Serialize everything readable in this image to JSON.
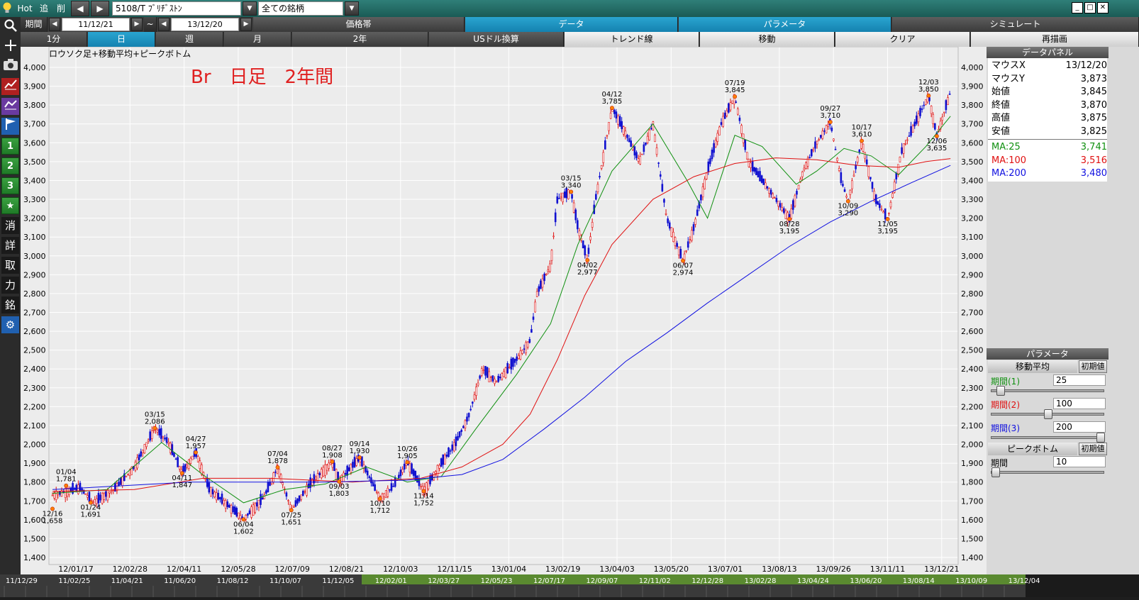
{
  "topbar": {
    "hot_label": "Hot",
    "add_label": "追",
    "delete_label": "削",
    "prev_label": "◀",
    "next_label": "▶",
    "stock_field": "5108/T ﾌﾞﾘﾁﾞｽﾄﾝ",
    "market_select": "全ての銘柄",
    "minimize": "_",
    "restore": "□",
    "close": "✕"
  },
  "toolbar1": {
    "period_label": "期間",
    "start_date": "11/12/21",
    "tilde": "~",
    "end_date": "13/12/20",
    "tabs": [
      "価格帯",
      "データ",
      "パラメータ",
      "シミュレート"
    ]
  },
  "toolbar2": {
    "timeframes": [
      "1分",
      "日",
      "週",
      "月",
      "2年"
    ],
    "actions": [
      "USドル換算",
      "トレンド線",
      "移動",
      "クリア",
      "再描画"
    ]
  },
  "left_toolbar": {
    "numbers": [
      "1",
      "2",
      "3"
    ],
    "kanji": [
      "消",
      "詳",
      "取",
      "力",
      "銘"
    ]
  },
  "chart_header": {
    "title": "ロウソク足+移動平均+ピークボトム",
    "note": "Br　日足　2年間"
  },
  "chart_data": {
    "type": "line",
    "title": "ロウソク足+移動平均+ピークボトム",
    "ylim": [
      1400,
      4000
    ],
    "y_ticks": [
      1400,
      1500,
      1600,
      1700,
      1800,
      1900,
      2000,
      2100,
      2200,
      2300,
      2400,
      2500,
      2600,
      2700,
      2800,
      2900,
      3000,
      3100,
      3200,
      3300,
      3400,
      3500,
      3600,
      3700,
      3800,
      3900,
      4000
    ],
    "y_tick_labels": [
      "1,400",
      "1,500",
      "1,600",
      "1,700",
      "1,800",
      "1,900",
      "2,000",
      "2,100",
      "2,200",
      "2,300",
      "2,400",
      "2,500",
      "2,600",
      "2,700",
      "2,800",
      "2,900",
      "3,000",
      "3,100",
      "3,200",
      "3,300",
      "3,400",
      "3,500",
      "3,600",
      "3,700",
      "3,800",
      "3,900",
      "4,000"
    ],
    "x_tick_labels": [
      "12/01/17",
      "12/02/28",
      "12/04/11",
      "12/05/28",
      "12/07/09",
      "12/08/21",
      "12/10/03",
      "12/11/15",
      "13/01/04",
      "13/02/19",
      "13/04/03",
      "13/05/20",
      "13/07/01",
      "13/08/13",
      "13/09/26",
      "13/11/11",
      "13/12/21"
    ],
    "bottom_dates": [
      "11/12/29",
      "11/02/25",
      "11/04/21",
      "11/06/20",
      "11/08/12",
      "11/10/07",
      "11/12/05",
      "12/02/01",
      "12/03/27",
      "12/05/23",
      "12/07/17",
      "12/09/07",
      "12/11/02",
      "12/12/28",
      "13/02/28",
      "13/04/24",
      "13/06/20",
      "13/08/14",
      "13/10/09",
      "13/12/04"
    ],
    "x_count": 500,
    "close_points": [
      [
        0,
        1730
      ],
      [
        20,
        1770
      ],
      [
        30,
        1691
      ],
      [
        45,
        1760
      ],
      [
        60,
        1880
      ],
      [
        75,
        2086
      ],
      [
        85,
        2010
      ],
      [
        95,
        1847
      ],
      [
        105,
        1957
      ],
      [
        115,
        1760
      ],
      [
        125,
        1700
      ],
      [
        140,
        1602
      ],
      [
        155,
        1720
      ],
      [
        165,
        1878
      ],
      [
        175,
        1651
      ],
      [
        190,
        1800
      ],
      [
        205,
        1908
      ],
      [
        210,
        1803
      ],
      [
        225,
        1930
      ],
      [
        240,
        1712
      ],
      [
        250,
        1780
      ],
      [
        260,
        1905
      ],
      [
        272,
        1752
      ],
      [
        285,
        1900
      ],
      [
        295,
        2000
      ],
      [
        305,
        2150
      ],
      [
        315,
        2400
      ],
      [
        325,
        2330
      ],
      [
        340,
        2450
      ],
      [
        350,
        2550
      ],
      [
        355,
        2800
      ],
      [
        365,
        2950
      ],
      [
        370,
        3300
      ],
      [
        380,
        3340
      ],
      [
        385,
        3150
      ],
      [
        392,
        2977
      ],
      [
        398,
        3300
      ],
      [
        410,
        3785
      ],
      [
        420,
        3650
      ],
      [
        430,
        3500
      ],
      [
        440,
        3700
      ],
      [
        450,
        3200
      ],
      [
        462,
        2974
      ],
      [
        470,
        3150
      ],
      [
        480,
        3450
      ],
      [
        490,
        3700
      ],
      [
        500,
        3845
      ],
      [
        510,
        3500
      ],
      [
        520,
        3400
      ],
      [
        530,
        3300
      ],
      [
        540,
        3195
      ],
      [
        550,
        3450
      ],
      [
        560,
        3600
      ],
      [
        570,
        3710
      ],
      [
        578,
        3400
      ],
      [
        583,
        3290
      ],
      [
        593,
        3610
      ],
      [
        603,
        3300
      ],
      [
        612,
        3195
      ],
      [
        622,
        3550
      ],
      [
        632,
        3700
      ],
      [
        642,
        3850
      ],
      [
        648,
        3635
      ],
      [
        658,
        3870
      ]
    ],
    "peaks": [
      {
        "i": 0,
        "label": "12/16",
        "value": "1,658",
        "pos": "below"
      },
      {
        "i": 10,
        "label": "01/04",
        "value": "1,781",
        "pos": "above"
      },
      {
        "i": 28,
        "label": "01/24",
        "value": "1,691",
        "pos": "below"
      },
      {
        "i": 75,
        "label": "03/15",
        "value": "2,086",
        "pos": "above"
      },
      {
        "i": 95,
        "label": "04/11",
        "value": "1,847",
        "pos": "below"
      },
      {
        "i": 105,
        "label": "04/27",
        "value": "1,957",
        "pos": "above"
      },
      {
        "i": 140,
        "label": "06/04",
        "value": "1,602",
        "pos": "below"
      },
      {
        "i": 165,
        "label": "07/04",
        "value": "1,878",
        "pos": "above"
      },
      {
        "i": 175,
        "label": "07/25",
        "value": "1,651",
        "pos": "below"
      },
      {
        "i": 205,
        "label": "08/27",
        "value": "1,908",
        "pos": "above"
      },
      {
        "i": 210,
        "label": "09/03",
        "value": "1,803",
        "pos": "below"
      },
      {
        "i": 225,
        "label": "09/14",
        "value": "1,930",
        "pos": "above"
      },
      {
        "i": 240,
        "label": "10/10",
        "value": "1,712",
        "pos": "below"
      },
      {
        "i": 260,
        "label": "10/26",
        "value": "1,905",
        "pos": "above"
      },
      {
        "i": 272,
        "label": "11/14",
        "value": "1,752",
        "pos": "below"
      },
      {
        "i": 380,
        "label": "03/15",
        "value": "3,340",
        "pos": "above"
      },
      {
        "i": 392,
        "label": "04/02",
        "value": "2,977",
        "pos": "below"
      },
      {
        "i": 410,
        "label": "04/12",
        "value": "3,785",
        "pos": "above"
      },
      {
        "i": 462,
        "label": "06/07",
        "value": "2,974",
        "pos": "below"
      },
      {
        "i": 500,
        "label": "07/19",
        "value": "3,845",
        "pos": "above"
      },
      {
        "i": 540,
        "label": "08/28",
        "value": "3,195",
        "pos": "below"
      },
      {
        "i": 570,
        "label": "09/27",
        "value": "3,710",
        "pos": "above"
      },
      {
        "i": 583,
        "label": "10/09",
        "value": "3,290",
        "pos": "below"
      },
      {
        "i": 593,
        "label": "10/17",
        "value": "3,610",
        "pos": "above"
      },
      {
        "i": 612,
        "label": "11/05",
        "value": "3,195",
        "pos": "below"
      },
      {
        "i": 642,
        "label": "12/03",
        "value": "3,850",
        "pos": "above"
      },
      {
        "i": 648,
        "label": "12/06",
        "value": "3,635",
        "pos": "below"
      }
    ],
    "series": [
      {
        "name": "MA:25",
        "color": "#109010"
      },
      {
        "name": "MA:100",
        "color": "#e01010"
      },
      {
        "name": "MA:200",
        "color": "#1010e0"
      }
    ],
    "ma_points": {
      "ma25": [
        [
          0,
          1740
        ],
        [
          40,
          1760
        ],
        [
          80,
          2010
        ],
        [
          110,
          1840
        ],
        [
          140,
          1690
        ],
        [
          170,
          1760
        ],
        [
          200,
          1790
        ],
        [
          230,
          1880
        ],
        [
          260,
          1800
        ],
        [
          285,
          1830
        ],
        [
          310,
          2080
        ],
        [
          340,
          2370
        ],
        [
          365,
          2640
        ],
        [
          385,
          3060
        ],
        [
          410,
          3450
        ],
        [
          440,
          3700
        ],
        [
          465,
          3400
        ],
        [
          480,
          3200
        ],
        [
          500,
          3640
        ],
        [
          520,
          3580
        ],
        [
          545,
          3380
        ],
        [
          560,
          3450
        ],
        [
          580,
          3570
        ],
        [
          600,
          3530
        ],
        [
          620,
          3430
        ],
        [
          640,
          3580
        ],
        [
          658,
          3741
        ]
      ],
      "ma100": [
        [
          0,
          1750
        ],
        [
          60,
          1760
        ],
        [
          110,
          1820
        ],
        [
          160,
          1820
        ],
        [
          220,
          1800
        ],
        [
          270,
          1820
        ],
        [
          300,
          1880
        ],
        [
          330,
          2000
        ],
        [
          350,
          2160
        ],
        [
          370,
          2450
        ],
        [
          390,
          2790
        ],
        [
          410,
          3060
        ],
        [
          440,
          3300
        ],
        [
          470,
          3420
        ],
        [
          500,
          3490
        ],
        [
          530,
          3520
        ],
        [
          560,
          3510
        ],
        [
          590,
          3480
        ],
        [
          620,
          3470
        ],
        [
          640,
          3500
        ],
        [
          658,
          3516
        ]
      ],
      "ma200": [
        [
          0,
          1760
        ],
        [
          100,
          1800
        ],
        [
          200,
          1800
        ],
        [
          260,
          1810
        ],
        [
          300,
          1840
        ],
        [
          330,
          1920
        ],
        [
          360,
          2080
        ],
        [
          390,
          2250
        ],
        [
          420,
          2440
        ],
        [
          450,
          2590
        ],
        [
          480,
          2750
        ],
        [
          510,
          2900
        ],
        [
          540,
          3050
        ],
        [
          570,
          3180
        ],
        [
          600,
          3290
        ],
        [
          630,
          3390
        ],
        [
          658,
          3480
        ]
      ]
    }
  },
  "data_panel": {
    "header": "データパネル",
    "rows": [
      {
        "k": "マウスX",
        "v": "13/12/20",
        "color": "#000000"
      },
      {
        "k": "マウスY",
        "v": "3,873",
        "color": "#000000"
      },
      {
        "k": "始値",
        "v": "3,845",
        "color": "#000000"
      },
      {
        "k": "終値",
        "v": "3,870",
        "color": "#000000"
      },
      {
        "k": "高値",
        "v": "3,875",
        "color": "#000000"
      },
      {
        "k": "安値",
        "v": "3,825",
        "color": "#000000"
      },
      {
        "k": "MA:25",
        "v": "3,741",
        "color": "#109010"
      },
      {
        "k": "MA:100",
        "v": "3,516",
        "color": "#e01010"
      },
      {
        "k": "MA:200",
        "v": "3,480",
        "color": "#1010e0"
      }
    ]
  },
  "param_panel": {
    "header": "パラメータ",
    "ma_head": "移動平均",
    "reset": "初期値",
    "periods": [
      {
        "label": "期間(1)",
        "value": "25",
        "color": "#109010",
        "level": 0.05
      },
      {
        "label": "期間(2)",
        "value": "100",
        "color": "#e01010",
        "level": 0.5
      },
      {
        "label": "期間(3)",
        "value": "200",
        "color": "#1010e0",
        "level": 1.0
      }
    ],
    "pb_head": "ピークボトム",
    "pb_reset": "初期値",
    "pb_label": "期間",
    "pb_value": "10",
    "pb_level": 0.0
  }
}
